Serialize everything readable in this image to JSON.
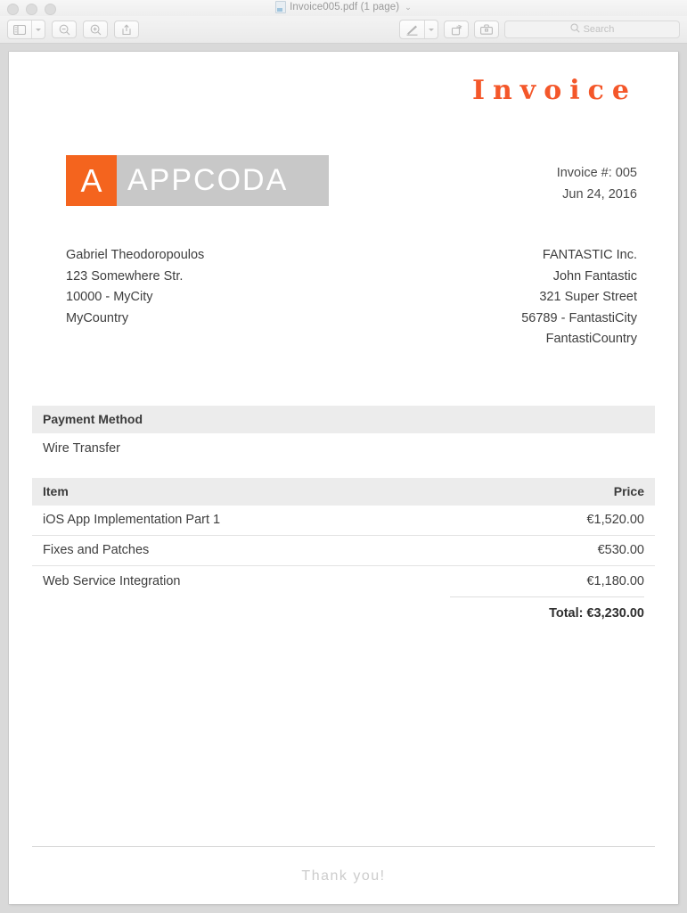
{
  "window": {
    "title": "Invoice005.pdf (1 page)",
    "title_chevron": "⌄",
    "traffic_lights": [
      "close",
      "minimize",
      "zoom"
    ]
  },
  "toolbar": {
    "sidebar_button": {
      "label": "",
      "icon": "sidebar-icon"
    },
    "sidebar_dropdown_icon": "chevron-down-icon",
    "zoom_out_button": {
      "icon": "zoom-out-icon"
    },
    "zoom_in_button": {
      "icon": "zoom-in-icon"
    },
    "share_button": {
      "icon": "share-icon"
    },
    "markup_button": {
      "icon": "markup-pen-icon"
    },
    "markup_dropdown_icon": "chevron-down-icon",
    "rotate_button": {
      "icon": "rotate-icon"
    },
    "toolbox_button": {
      "icon": "toolbox-icon"
    },
    "search": {
      "placeholder": "Search",
      "value": "",
      "icon": "search-icon"
    }
  },
  "document": {
    "heading": "Invoice",
    "heading_color": "#f4572a",
    "logo": {
      "mark": "A",
      "name": "APPCODA",
      "mark_color": "#f4641e",
      "name_bg_color": "#c8c8c8"
    },
    "meta": {
      "invoice_number": "Invoice #: 005",
      "date": "Jun 24, 2016"
    },
    "bill_from": [
      "Gabriel Theodoropoulos",
      "123 Somewhere Str.",
      "10000 - MyCity",
      "MyCountry"
    ],
    "bill_to": [
      "FANTASTIC Inc.",
      "John Fantastic",
      "321 Super Street",
      "56789 - FantastiCity",
      "FantastiCountry"
    ],
    "payment": {
      "header": "Payment Method",
      "value": "Wire Transfer"
    },
    "items_table": {
      "columns": [
        "Item",
        "Price"
      ],
      "rows": [
        {
          "item": "iOS App Implementation Part 1",
          "price": "€1,520.00"
        },
        {
          "item": "Fixes and Patches",
          "price": "€530.00"
        },
        {
          "item": "Web Service Integration",
          "price": "€1,180.00"
        }
      ],
      "total": "Total: €3,230.00"
    },
    "footer": {
      "thanks": "Thank you!"
    }
  }
}
